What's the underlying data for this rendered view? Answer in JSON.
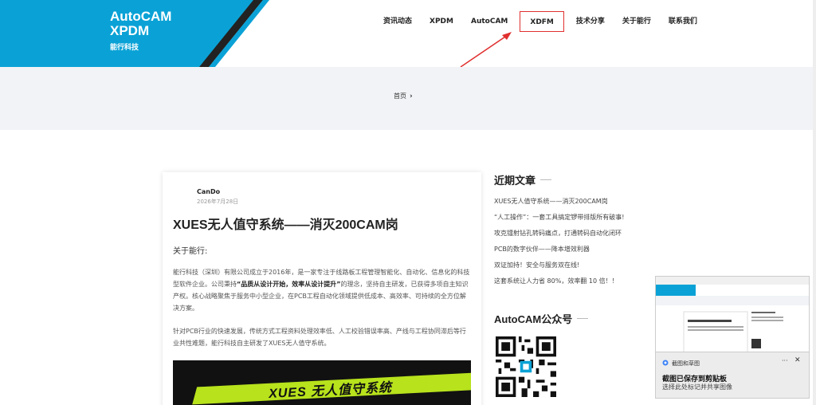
{
  "brand": {
    "line1": "AutoCAM",
    "line2": "XPDM",
    "sub": "能行科技"
  },
  "nav": {
    "items": [
      "资讯动态",
      "XPDM",
      "AutoCAM",
      "XDFM",
      "技术分享",
      "关于能行",
      "联系我们"
    ],
    "highlighted_index": 3
  },
  "breadcrumb": {
    "home": "首页"
  },
  "article": {
    "author": "CanDo",
    "date": "2026年7月28日",
    "title": "XUES无人值守系统——消灭200CAM岗",
    "subhead": "关于能行:",
    "p1_a": "能行科技（深圳）有限公司成立于2016年，是一家专注于线路板工程管理智能化、自动化、信息化的科技型软件企业。公司秉持",
    "p1_bold": "“品质从设计开始，效率从设计提升”",
    "p1_b": "的理念，坚持自主研发，已获得多项自主知识产权。核心战略聚焦于服务中小型企业，在PCB工程自动化领域提供低成本、高效率、可持续的全方位解决方案。",
    "p2": "针对PCB行业的快速发展，传统方式工程资料处理效率低、人工校验错误率高、产线与工程协同滞后等行业共性难题，能行科技自主研发了XUES无人值守系统。",
    "banner_text": "XUES 无人值守系统"
  },
  "sidebar": {
    "recent_title": "近期文章",
    "recent": [
      "XUES无人值守系统——消灭200CAM岗",
      "“人工操作”：一套工具搞定锣带排版所有破事!",
      "攻克镭射钻孔转码痛点，打通转码自动化闭环",
      "PCB的数字伙伴——降本增效利器",
      "双证加持！安全与服务双在线!",
      "这套系统让人力省 80%，效率翻 10 倍！！"
    ],
    "qr_title": "AutoCAM公众号"
  },
  "toast": {
    "app": "截图和草图",
    "more": "···",
    "close": "✕",
    "title": "截图已保存到剪贴板",
    "body": "选择此处标记并共享图像"
  },
  "colors": {
    "brand": "#0aa2d6",
    "highlight": "#e0302f"
  }
}
